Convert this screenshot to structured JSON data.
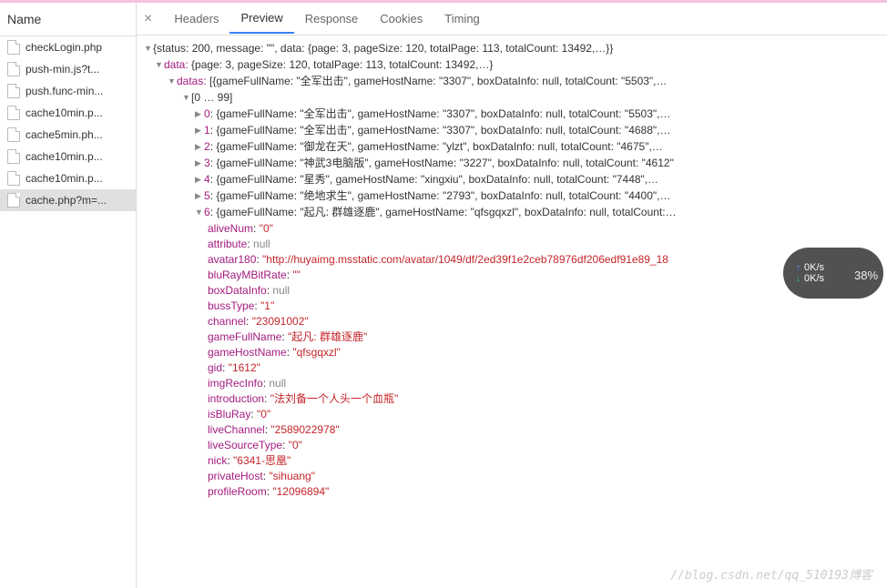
{
  "sidebar": {
    "header": "Name",
    "items": [
      {
        "label": "checkLogin.php"
      },
      {
        "label": "push-min.js?t..."
      },
      {
        "label": "push.func-min..."
      },
      {
        "label": "cache10min.p..."
      },
      {
        "label": "cache5min.ph..."
      },
      {
        "label": "cache10min.p..."
      },
      {
        "label": "cache10min.p..."
      },
      {
        "label": "cache.php?m=..."
      }
    ],
    "selected_index": 7
  },
  "tabs": {
    "close": "×",
    "items": [
      "Headers",
      "Preview",
      "Response",
      "Cookies",
      "Timing"
    ],
    "active_index": 1
  },
  "preview": {
    "root_summary": "{status: 200, message: \"\", data: {page: 3, pageSize: 120, totalPage: 113, totalCount: 13492,…}}",
    "data_summary": "{page: 3, pageSize: 120, totalPage: 113, totalCount: 13492,…}",
    "data_key": "data:",
    "datas_key": "datas:",
    "datas_summary": "[{gameFullName: \"全军出击\", gameHostName: \"3307\", boxDataInfo: null, totalCount: \"5503\",…",
    "range": "[0 … 99]",
    "rows": [
      {
        "idx": "0",
        "summary": "{gameFullName: \"全军出击\", gameHostName: \"3307\", boxDataInfo: null, totalCount: \"5503\",…"
      },
      {
        "idx": "1",
        "summary": "{gameFullName: \"全军出击\", gameHostName: \"3307\", boxDataInfo: null, totalCount: \"4688\",…"
      },
      {
        "idx": "2",
        "summary": "{gameFullName: \"御龙在天\", gameHostName: \"ylzt\", boxDataInfo: null, totalCount: \"4675\",…"
      },
      {
        "idx": "3",
        "summary": "{gameFullName: \"神武3电脑版\", gameHostName: \"3227\", boxDataInfo: null, totalCount: \"4612\""
      },
      {
        "idx": "4",
        "summary": "{gameFullName: \"星秀\", gameHostName: \"xingxiu\", boxDataInfo: null, totalCount: \"7448\",…"
      },
      {
        "idx": "5",
        "summary": "{gameFullName: \"绝地求生\", gameHostName: \"2793\", boxDataInfo: null, totalCount: \"4400\",…"
      },
      {
        "idx": "6",
        "summary": "{gameFullName: \"起凡: 群雄逐鹿\", gameHostName: \"qfsgqxzl\", boxDataInfo: null, totalCount:…"
      }
    ],
    "expanded": {
      "aliveNum": {
        "k": "aliveNum",
        "v": "\"0\"",
        "t": "str"
      },
      "attribute": {
        "k": "attribute",
        "v": "null",
        "t": "null"
      },
      "avatar180": {
        "k": "avatar180",
        "v": "\"http://huyaimg.msstatic.com/avatar/1049/df/2ed39f1e2ceb78976df206edf91e89_18",
        "t": "str"
      },
      "bluRayMBitRate": {
        "k": "bluRayMBitRate",
        "v": "\"\"",
        "t": "str"
      },
      "boxDataInfo": {
        "k": "boxDataInfo",
        "v": "null",
        "t": "null"
      },
      "bussType": {
        "k": "bussType",
        "v": "\"1\"",
        "t": "str"
      },
      "channel": {
        "k": "channel",
        "v": "\"23091002\"",
        "t": "str"
      },
      "gameFullName": {
        "k": "gameFullName",
        "v": "\"起凡: 群雄逐鹿\"",
        "t": "str"
      },
      "gameHostName": {
        "k": "gameHostName",
        "v": "\"qfsgqxzl\"",
        "t": "str"
      },
      "gid": {
        "k": "gid",
        "v": "\"1612\"",
        "t": "str"
      },
      "imgRecInfo": {
        "k": "imgRecInfo",
        "v": "null",
        "t": "null"
      },
      "introduction": {
        "k": "introduction",
        "v": "\"法刘备一个人头一个血瓶\"",
        "t": "str"
      },
      "isBluRay": {
        "k": "isBluRay",
        "v": "\"0\"",
        "t": "str"
      },
      "liveChannel": {
        "k": "liveChannel",
        "v": "\"2589022978\"",
        "t": "str"
      },
      "liveSourceType": {
        "k": "liveSourceType",
        "v": "\"0\"",
        "t": "str"
      },
      "nick": {
        "k": "nick",
        "v": "\"6341-思凰\"",
        "t": "str"
      },
      "privateHost": {
        "k": "privateHost",
        "v": "\"sihuang\"",
        "t": "str"
      },
      "profileRoom": {
        "k": "profileRoom",
        "v": "\"12096894\"",
        "t": "str"
      }
    }
  },
  "badge": {
    "up": "0K/s",
    "down": "0K/s",
    "pct": "38",
    "pct_suffix": "%"
  },
  "watermark": "//blog.csdn.net/qq_510193博客"
}
